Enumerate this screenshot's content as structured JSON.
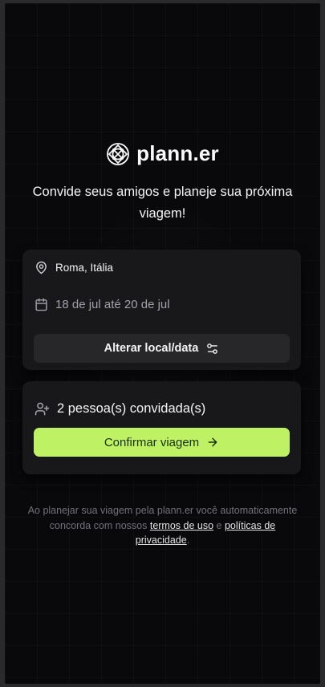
{
  "app": {
    "name": "plann.er",
    "tagline": "Convide seus amigos e planeje sua próxima viagem!"
  },
  "trip": {
    "location": "Roma, Itália",
    "dates": "18 de jul até 20 de jul",
    "change_button": "Alterar local/data"
  },
  "guests": {
    "summary": "2 pessoa(s) convidada(s)",
    "confirm_button": "Confirmar viagem"
  },
  "footer": {
    "line1": "Ao planejar sua viagem pela plann.er você automaticamente concorda com nossos",
    "terms_link": "termos de uso",
    "connector": "e",
    "privacy_link": "políticas de privacidade",
    "end": "."
  },
  "icons": [
    "logo-icon",
    "map-pin-icon",
    "calendar-icon",
    "settings-sliders-icon",
    "user-plus-icon",
    "arrow-right-icon"
  ],
  "colors": {
    "background": "#09090b",
    "card": "#18181b",
    "secondary_button": "#27272a",
    "primary_button": "#bef264",
    "primary_text": "#1a2e05",
    "muted_text": "#71717a"
  }
}
